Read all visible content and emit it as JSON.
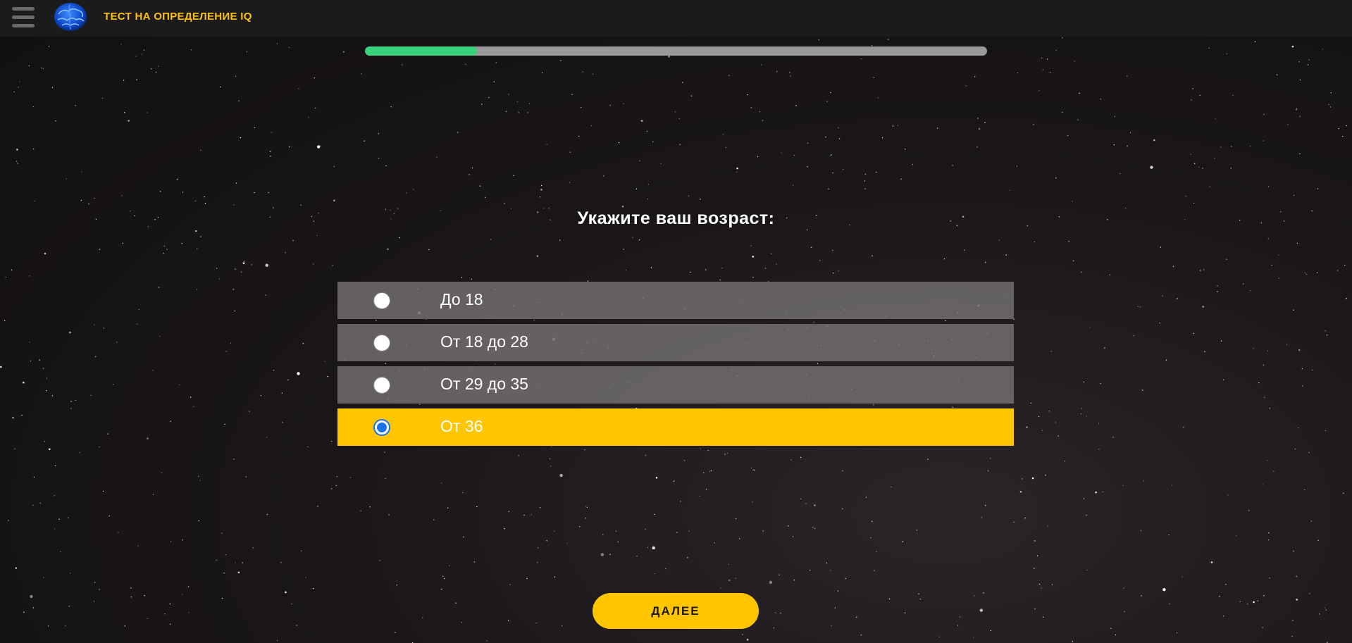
{
  "header": {
    "title": "ТЕСТ НА ОПРЕДЕЛЕНИЕ IQ",
    "menu_icon": "hamburger-menu-icon",
    "logo_icon": "brain-logo-icon"
  },
  "progress": {
    "fraction": 0.18
  },
  "question": {
    "text": "Укажите ваш возраст:"
  },
  "options": [
    {
      "label": "До 18",
      "selected": false
    },
    {
      "label": "От 18 до 28",
      "selected": false
    },
    {
      "label": "От 29 до 35",
      "selected": false
    },
    {
      "label": "От 36",
      "selected": true
    }
  ],
  "next_button": {
    "label": "ДАЛЕЕ"
  },
  "colors": {
    "accent": "#ffc600",
    "title": "#ffc107",
    "progress_fill": "#3ad27a",
    "progress_track": "#9a9a9a",
    "radio_selected": "#1a73e8",
    "topbar": "#1b1b1b"
  }
}
